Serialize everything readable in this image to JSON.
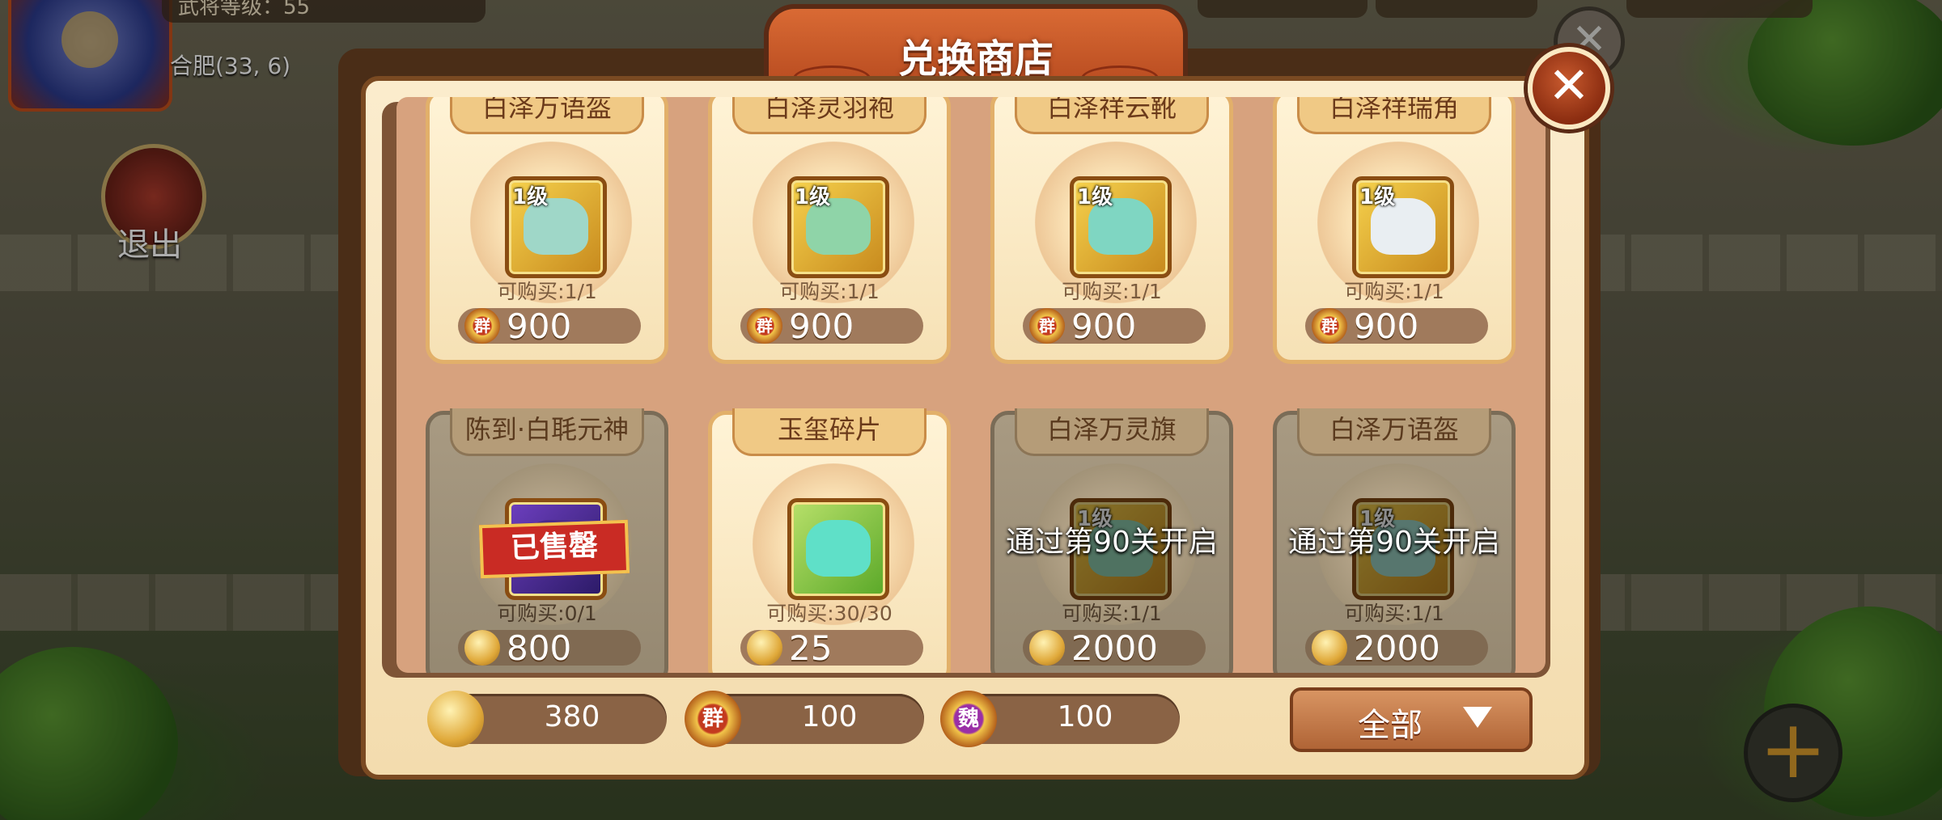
{
  "hud": {
    "level_text": "武将等级：55",
    "city": "合肥(33, 6)",
    "exit_label": "退出"
  },
  "dialog": {
    "title": "兑换商店",
    "close_glyph": "✕"
  },
  "items": [
    {
      "name": "白泽万语盔",
      "level": "1级",
      "buy": "可购买:1/1",
      "price": "900",
      "currency": "qun-coin-icon",
      "art_color": "#9fd7c8",
      "state": "available"
    },
    {
      "name": "白泽灵羽袍",
      "level": "1级",
      "buy": "可购买:1/1",
      "price": "900",
      "currency": "qun-coin-icon",
      "art_color": "#8fd4a8",
      "state": "available"
    },
    {
      "name": "白泽祥云靴",
      "level": "1级",
      "buy": "可购买:1/1",
      "price": "900",
      "currency": "qun-coin-icon",
      "art_color": "#7fd6c2",
      "state": "available"
    },
    {
      "name": "白泽祥瑞角",
      "level": "1级",
      "buy": "可购买:1/1",
      "price": "900",
      "currency": "qun-coin-icon",
      "art_color": "#e9eef2",
      "state": "available"
    },
    {
      "name": "陈到·白毦元神",
      "level": "",
      "buy": "可购买:0/1",
      "price": "800",
      "currency": "silver-coin-icon",
      "art_color": "#4b2b8c",
      "state": "sold",
      "badge": "已售罄"
    },
    {
      "name": "玉玺碎片",
      "level": "",
      "buy": "可购买:30/30",
      "price": "25",
      "currency": "silver-coin-icon",
      "art_color": "#5fe0c8",
      "state": "available"
    },
    {
      "name": "白泽万灵旗",
      "level": "1级",
      "buy": "可购买:1/1",
      "price": "2000",
      "currency": "silver-coin-icon",
      "art_color": "#8fcfb0",
      "state": "locked",
      "lock_text": "通过第90关开启"
    },
    {
      "name": "白泽万语盔",
      "level": "1级",
      "buy": "可购买:1/1",
      "price": "2000",
      "currency": "silver-coin-icon",
      "art_color": "#9fd7c8",
      "state": "locked",
      "lock_text": "通过第90关开启"
    }
  ],
  "currencies": [
    {
      "icon": "silver-coin-icon",
      "value": "380"
    },
    {
      "icon": "qun-coin-icon",
      "value": "100",
      "glyph": "群"
    },
    {
      "icon": "wei-coin-icon",
      "value": "100",
      "glyph": "魏"
    }
  ],
  "filter": {
    "label": "全部",
    "icon": "chevron-down-icon"
  },
  "coin_glyphs": {
    "qun": "群"
  },
  "colors": {
    "dialog_bg": "#f3dcae",
    "title_bg": "#c75528",
    "price_pill": "#a07a5c",
    "sold_red": "#c92b24"
  }
}
